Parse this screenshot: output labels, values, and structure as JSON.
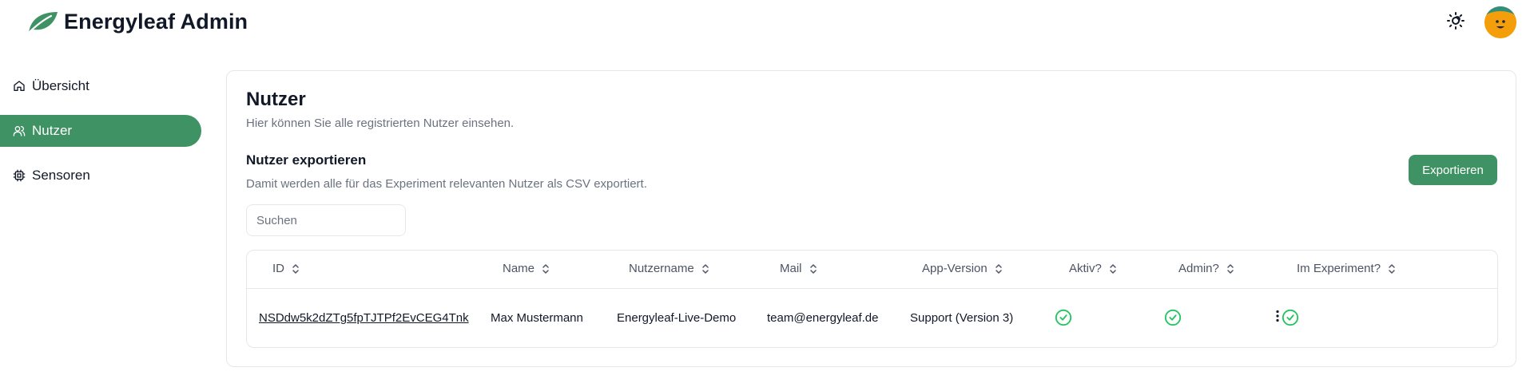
{
  "header": {
    "title": "Energyleaf Admin",
    "logo_icon": "leaf-icon",
    "theme_icon": "sun-moon-icon",
    "brand_color": "#3f9264"
  },
  "sidebar": {
    "items": [
      {
        "label": "Übersicht",
        "icon": "home-icon",
        "active": false
      },
      {
        "label": "Nutzer",
        "icon": "users-icon",
        "active": true
      },
      {
        "label": "Sensoren",
        "icon": "cpu-icon",
        "active": false
      }
    ]
  },
  "main": {
    "title": "Nutzer",
    "subtitle": "Hier können Sie alle registrierten Nutzer einsehen.",
    "export": {
      "title": "Nutzer exportieren",
      "description": "Damit werden alle für das Experiment relevanten Nutzer als CSV exportiert.",
      "button_label": "Exportieren"
    },
    "search": {
      "placeholder": "Suchen",
      "value": ""
    },
    "table": {
      "columns": [
        "ID",
        "Name",
        "Nutzername",
        "Mail",
        "App-Version",
        "Aktiv?",
        "Admin?",
        "Im Experiment?"
      ],
      "rows": [
        {
          "id": "NSDdw5k2dZTg5fpTJTPf2EvCEG4Tnk",
          "name": "Max Mustermann",
          "username": "Energyleaf-Live-Demo",
          "mail": "team@energyleaf.de",
          "app_version": "Support (Version 3)",
          "active": true,
          "admin": true,
          "experiment": true
        }
      ]
    }
  }
}
